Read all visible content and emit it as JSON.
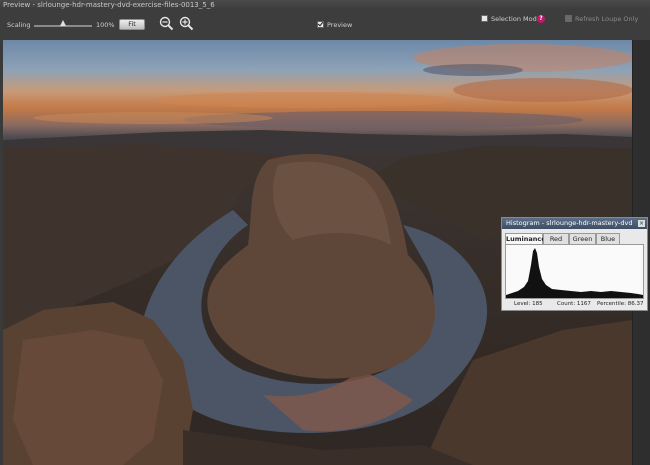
{
  "window": {
    "title": "Preview - slrlounge-hdr-mastery-dvd-exercise-files-0013_5_6"
  },
  "toolbar": {
    "scaling_label": "Scaling",
    "scaling_value": "100%",
    "scaling_level": 0.5,
    "fit_label": "Fit",
    "zoom_out_icon": "zoom-out-icon",
    "zoom_in_icon": "zoom-in-icon",
    "preview_label": "Preview",
    "preview_checked": true,
    "selection_mode_label": "Selection Mode",
    "selection_mode_checked": false,
    "refresh_label": "Refresh Loupe Only",
    "refresh_checked": false
  },
  "histogram": {
    "title": "Histogram - slrlounge-hdr-mastery-dvd",
    "tabs": [
      {
        "label": "Luminance",
        "active": true
      },
      {
        "label": "Red",
        "active": false
      },
      {
        "label": "Green",
        "active": false
      },
      {
        "label": "Blue",
        "active": false
      }
    ],
    "level_label": "Level: 185",
    "count_label": "Count: 1167",
    "percentile_label": "Percentile: 86.37"
  },
  "colors": {
    "accent": "#c2186b",
    "panel_title": "#4a5a74",
    "toolbar_bg": "#3d3d3d"
  }
}
